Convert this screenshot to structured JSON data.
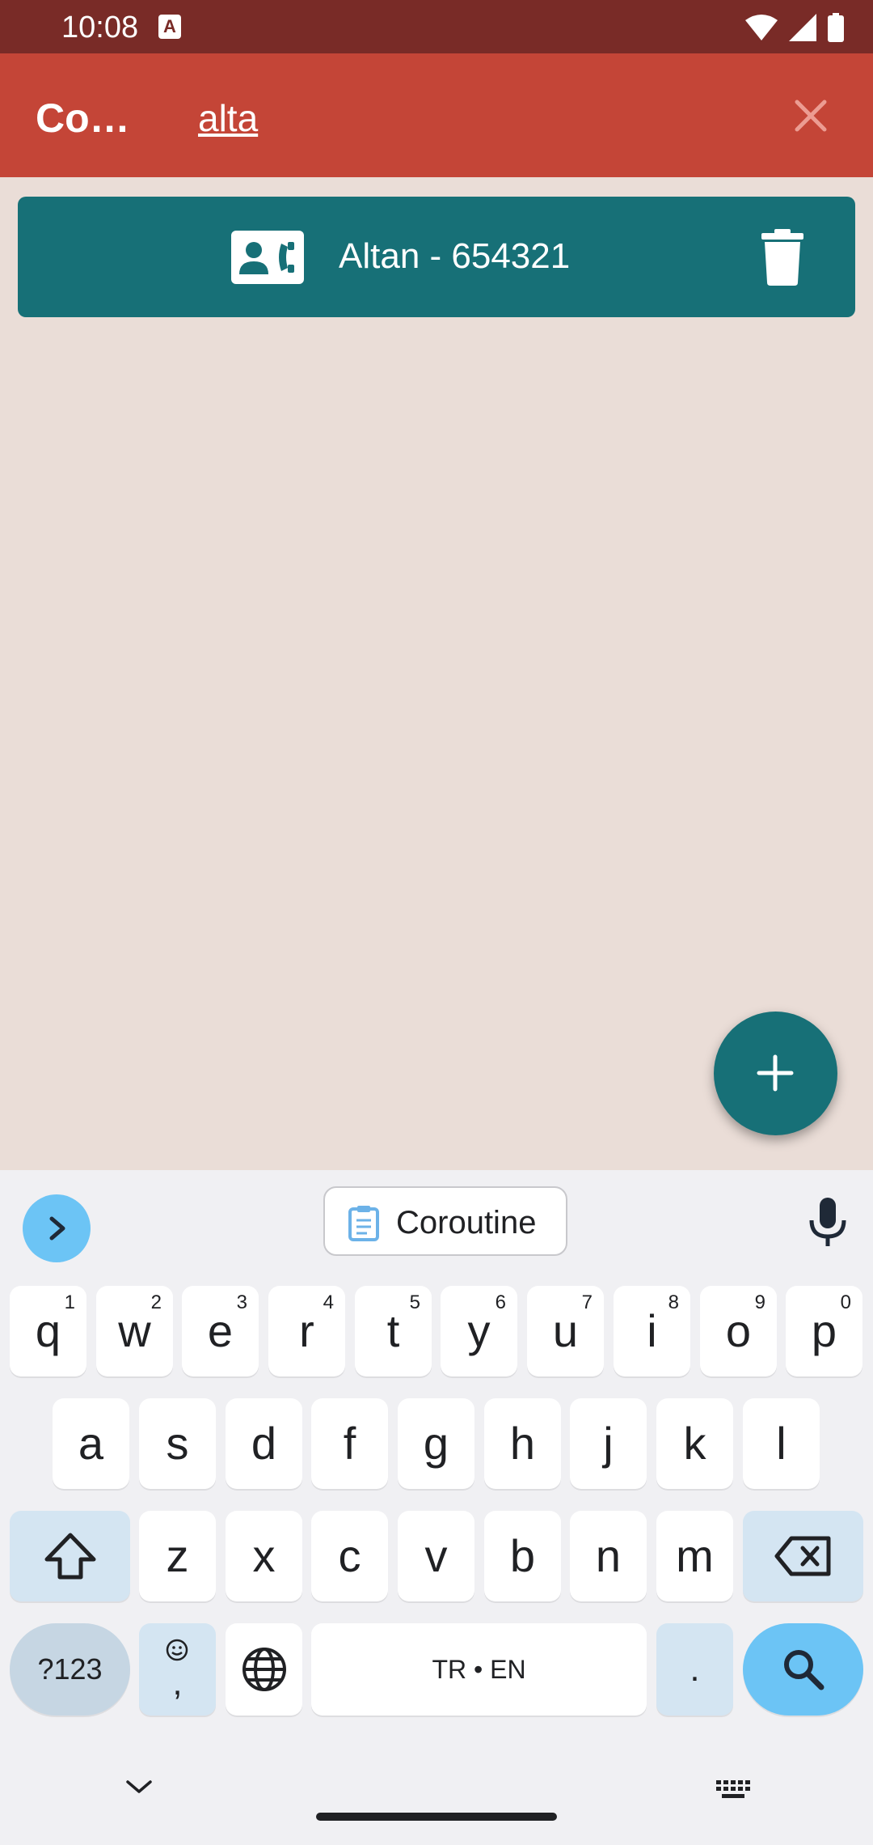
{
  "status_bar": {
    "time": "10:08",
    "notification_icon": "A"
  },
  "app_bar": {
    "title": "Co…",
    "search_query": "alta",
    "close_icon": "close-icon"
  },
  "contacts": [
    {
      "label": "Altan - 654321"
    }
  ],
  "keyboard": {
    "suggestion": "Coroutine",
    "row1": [
      {
        "key": "q",
        "sub": "1"
      },
      {
        "key": "w",
        "sub": "2"
      },
      {
        "key": "e",
        "sub": "3"
      },
      {
        "key": "r",
        "sub": "4"
      },
      {
        "key": "t",
        "sub": "5"
      },
      {
        "key": "y",
        "sub": "6"
      },
      {
        "key": "u",
        "sub": "7"
      },
      {
        "key": "i",
        "sub": "8"
      },
      {
        "key": "o",
        "sub": "9"
      },
      {
        "key": "p",
        "sub": "0"
      }
    ],
    "row2": [
      "a",
      "s",
      "d",
      "f",
      "g",
      "h",
      "j",
      "k",
      "l"
    ],
    "row3": [
      "z",
      "x",
      "c",
      "v",
      "b",
      "n",
      "m"
    ],
    "symbols_label": "?123",
    "comma_label": ",",
    "space_label": "TR • EN",
    "period_label": "."
  },
  "colors": {
    "status_bar": "#792b27",
    "app_bar": "#c44537",
    "background": "#eaddd7",
    "card": "#177077",
    "keyboard_accent": "#6cc4f5"
  }
}
